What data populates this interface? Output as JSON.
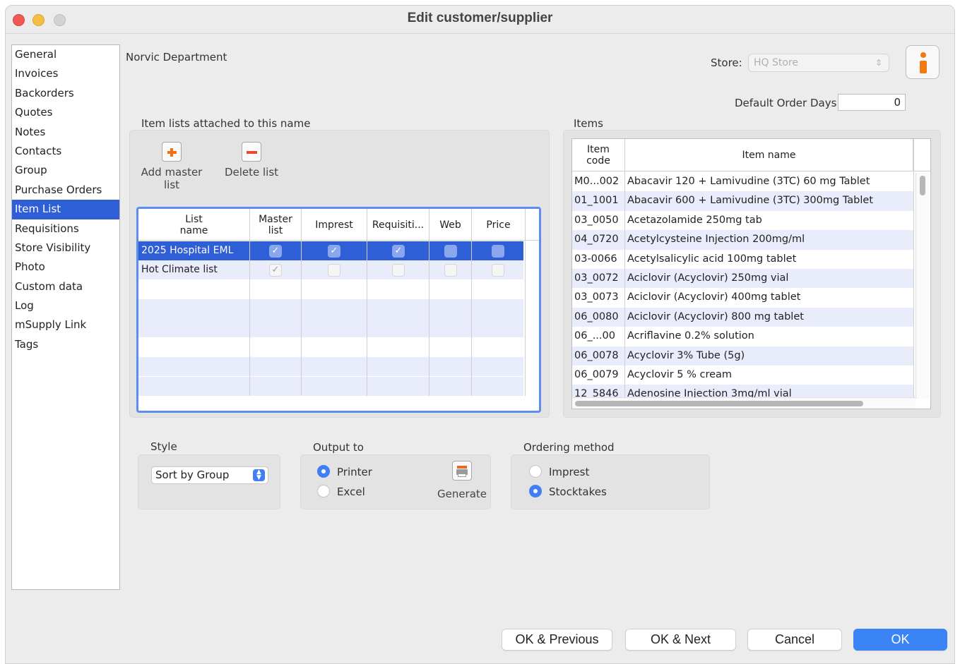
{
  "window": {
    "title": "Edit customer/supplier"
  },
  "sidebar": {
    "items": [
      {
        "label": "General"
      },
      {
        "label": "Invoices"
      },
      {
        "label": "Backorders"
      },
      {
        "label": "Quotes"
      },
      {
        "label": "Notes"
      },
      {
        "label": "Contacts"
      },
      {
        "label": "Group"
      },
      {
        "label": "Purchase Orders"
      },
      {
        "label": "Item List",
        "active": true
      },
      {
        "label": "Requisitions"
      },
      {
        "label": "Store Visibility"
      },
      {
        "label": "Photo"
      },
      {
        "label": "Custom data"
      },
      {
        "label": "Log"
      },
      {
        "label": "mSupply Link"
      },
      {
        "label": "Tags"
      }
    ]
  },
  "header": {
    "name": "Norvic Department",
    "store_label": "Store:",
    "store_value": "HQ Store",
    "default_order_days_label": "Default Order Days",
    "default_order_days_value": "0"
  },
  "item_lists": {
    "group_label": "Item lists attached to this name",
    "add_label_1": "Add master",
    "add_label_2": "list",
    "delete_label": "Delete list",
    "columns": {
      "list_name_1": "List",
      "list_name_2": "name",
      "master_1": "Master",
      "master_2": "list",
      "imprest": "Imprest",
      "requisition": "Requisiti...",
      "web": "Web",
      "price": "Price"
    },
    "rows": [
      {
        "name": "2025 Hospital EML",
        "master": true,
        "imprest": true,
        "requisition": true,
        "web": false,
        "price": false,
        "selected": true
      },
      {
        "name": "Hot Climate list",
        "master": true,
        "imprest": false,
        "requisition": false,
        "web": false,
        "price": false,
        "selected": false
      }
    ]
  },
  "items": {
    "group_label": "Items",
    "columns": {
      "code_1": "Item",
      "code_2": "code",
      "name": "Item name"
    },
    "rows": [
      {
        "code": "M0...002",
        "name": "Abacavir 120 + Lamivudine (3TC) 60 mg Tablet"
      },
      {
        "code": "01_1001",
        "name": "Abacavir 600 + Lamivudine (3TC) 300mg Tablet"
      },
      {
        "code": "03_0050",
        "name": "Acetazolamide 250mg tab"
      },
      {
        "code": "04_0720",
        "name": "Acetylcysteine Injection 200mg/ml"
      },
      {
        "code": "03-0066",
        "name": "Acetylsalicylic acid 100mg tablet"
      },
      {
        "code": "03_0072",
        "name": "Aciclovir (Acyclovir) 250mg vial"
      },
      {
        "code": "03_0073",
        "name": "Aciclovir (Acyclovir) 400mg tablet"
      },
      {
        "code": "06_0080",
        "name": "Aciclovir (Acyclovir) 800 mg tablet"
      },
      {
        "code": "06_...00",
        "name": "Acriflavine 0.2% solution"
      },
      {
        "code": "06_0078",
        "name": "Acyclovir 3% Tube (5g)"
      },
      {
        "code": "06_0079",
        "name": "Acyclovir 5 % cream"
      },
      {
        "code": "12_5846",
        "name": "Adenosine Injection 3mg/ml vial"
      }
    ]
  },
  "style": {
    "label": "Style",
    "value": "Sort by Group"
  },
  "output": {
    "label": "Output to",
    "printer": "Printer",
    "excel": "Excel",
    "selected": "Printer",
    "generate": "Generate"
  },
  "ordering": {
    "label": "Ordering method",
    "imprest": "Imprest",
    "stocktakes": "Stocktakes",
    "selected": "Stocktakes"
  },
  "footer": {
    "ok_previous": "OK & Previous",
    "ok_next": "OK & Next",
    "cancel": "Cancel",
    "ok": "OK"
  },
  "colors": {
    "selection": "#2f5fd6",
    "accent": "#3a84f5",
    "alt_row": "#e8ecfb"
  }
}
